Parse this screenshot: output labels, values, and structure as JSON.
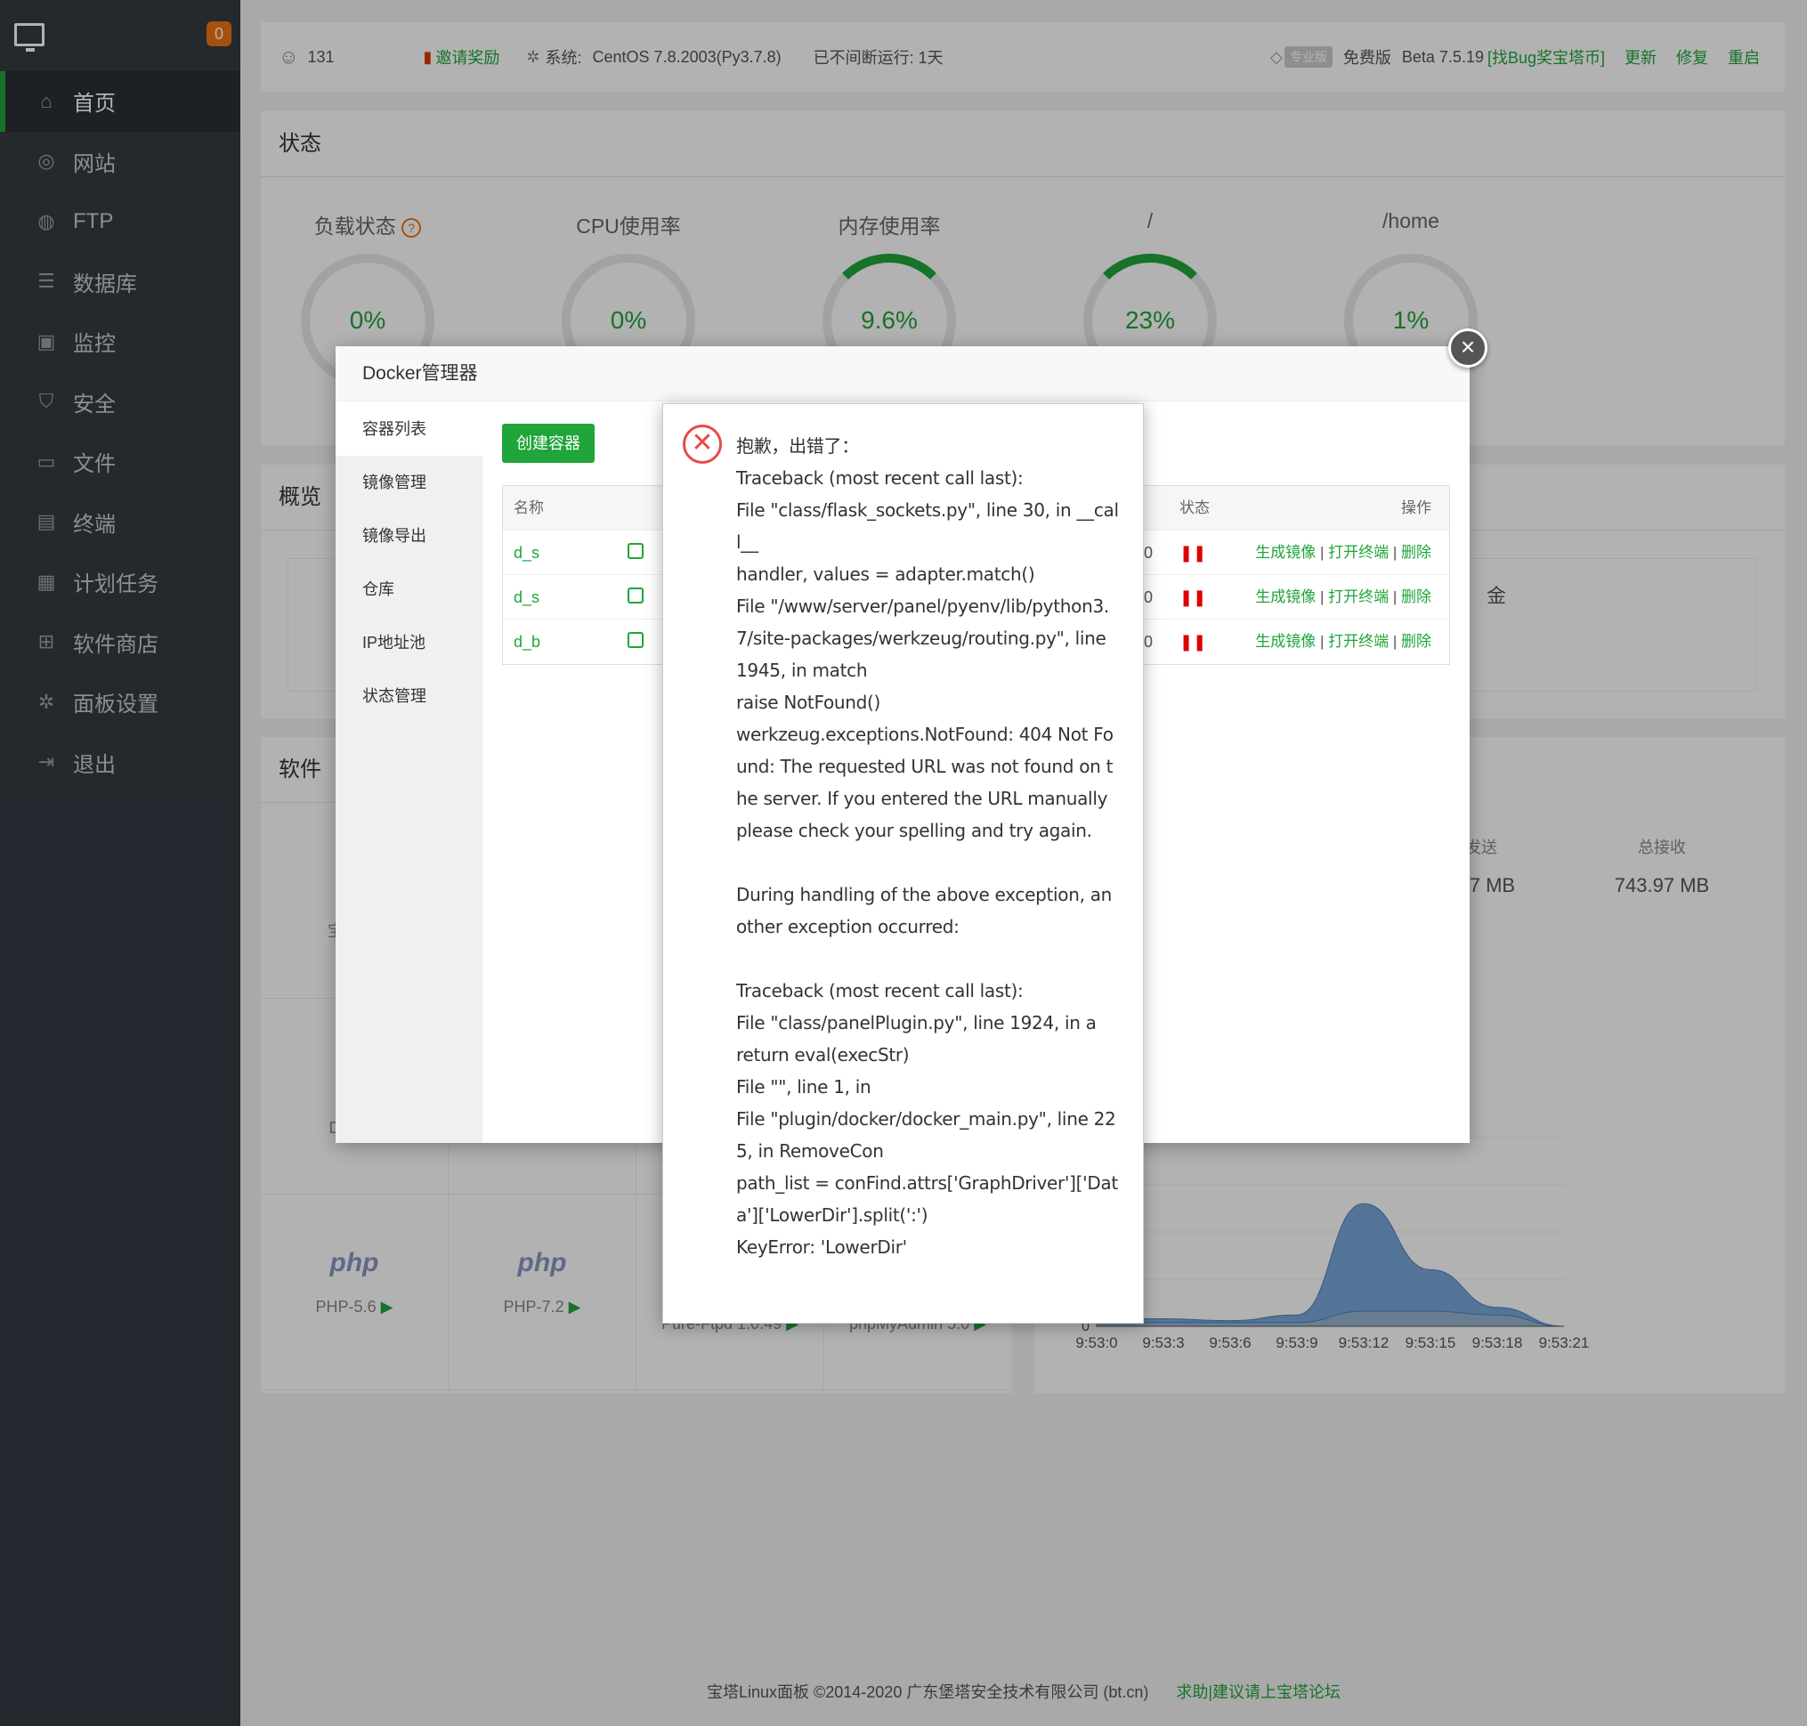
{
  "sidebar": {
    "badge": "0",
    "items": [
      {
        "label": "首页",
        "icon": "home-icon"
      },
      {
        "label": "网站",
        "icon": "globe-icon"
      },
      {
        "label": "FTP",
        "icon": "ftp-icon"
      },
      {
        "label": "数据库",
        "icon": "database-icon"
      },
      {
        "label": "监控",
        "icon": "monitor-icon"
      },
      {
        "label": "安全",
        "icon": "shield-icon"
      },
      {
        "label": "文件",
        "icon": "folder-icon"
      },
      {
        "label": "终端",
        "icon": "terminal-icon"
      },
      {
        "label": "计划任务",
        "icon": "calendar-icon"
      },
      {
        "label": "软件商店",
        "icon": "apps-icon"
      },
      {
        "label": "面板设置",
        "icon": "gear-icon"
      },
      {
        "label": "退出",
        "icon": "logout-icon"
      }
    ]
  },
  "topbar": {
    "user_count": "131",
    "invite": "邀请奖励",
    "system_label": "系统:",
    "system_value": "CentOS 7.8.2003(Py3.7.8)",
    "uptime": "已不间断运行: 1天",
    "pro_badge": "专业版",
    "free": "免费版",
    "version": "Beta 7.5.19",
    "bug_link": "[找Bug奖宝塔币]",
    "update": "更新",
    "repair": "修复",
    "restart": "重启"
  },
  "status": {
    "title": "状态",
    "gauges": [
      {
        "label": "负载状态",
        "value": "0%"
      },
      {
        "label": "CPU使用率",
        "value": "0%"
      },
      {
        "label": "内存使用率",
        "value": "9.6%"
      },
      {
        "label": "/",
        "value": "23%"
      },
      {
        "label": "/home",
        "value": "1%"
      }
    ]
  },
  "overview": {
    "title": "概览",
    "partial": "金"
  },
  "software": {
    "title": "软件",
    "items": [
      {
        "name": "宝塔SS"
      },
      {
        "name": "Docker"
      },
      {
        "name": "PHP-5.6",
        "logo": "php"
      },
      {
        "name": "PHP-7.2",
        "logo": "php"
      },
      {
        "name": "Pure-Ftpd 1.0.49"
      },
      {
        "name": "phpMyAdmin 5.0"
      }
    ]
  },
  "traffic": {
    "sent_label": "总发送",
    "sent_value": "35.57 MB",
    "recv_label": "总接收",
    "recv_value": "743.97 MB"
  },
  "chart_data": {
    "type": "area",
    "x": [
      "9:53:0",
      "9:53:3",
      "9:53:6",
      "9:53:9",
      "9:53:12",
      "9:53:15",
      "9:53:18",
      "9:53:21"
    ],
    "series": [
      {
        "values": [
          4,
          4,
          3,
          6,
          65,
          30,
          10,
          0
        ]
      },
      {
        "values": [
          2,
          2,
          2,
          2,
          8,
          8,
          6,
          0
        ]
      }
    ],
    "ylabel": "",
    "xlabel": "",
    "ylim": [
      0,
      100
    ],
    "y_tick_shown": "0",
    "colors": [
      "#6a9ed6",
      "#9fb6cc"
    ]
  },
  "dialog": {
    "title": "Docker管理器",
    "tabs": [
      "容器列表",
      "镜像管理",
      "镜像导出",
      "仓库",
      "IP地址池",
      "状态管理"
    ],
    "create_button": "创建容器",
    "table": {
      "headers": {
        "name": "名称",
        "status": "状态",
        "op": "操作"
      },
      "rows": [
        {
          "name": "d_s",
          "zero": "0",
          "status": "❚❚"
        },
        {
          "name": "d_s",
          "zero": "0",
          "status": "❚❚"
        },
        {
          "name": "d_b",
          "zero": "0",
          "status": "❚❚"
        }
      ],
      "ops": {
        "image": "生成镜像",
        "terminal": "打开终端",
        "delete": "删除",
        "sep": "|"
      }
    }
  },
  "error": {
    "message": "抱歉，出错了：\nTraceback (most recent call last):\nFile \"class/flask_sockets.py\", line 30, in __call__\nhandler, values = adapter.match()\nFile \"/www/server/panel/pyenv/lib/python3.7/site-packages/werkzeug/routing.py\", line 1945, in match\nraise NotFound()\nwerkzeug.exceptions.NotFound: 404 Not Found: The requested URL was not found on the server. If you entered the URL manually please check your spelling and try again.\n\nDuring handling of the above exception, another exception occurred:\n\nTraceback (most recent call last):\nFile \"class/panelPlugin.py\", line 1924, in a\nreturn eval(execStr)\nFile \"\", line 1, in\nFile \"plugin/docker/docker_main.py\", line 225, in RemoveCon\npath_list = conFind.attrs['GraphDriver']['Data']['LowerDir'].split(':')\nKeyError: 'LowerDir'"
  },
  "footer": {
    "copyright": "宝塔Linux面板 ©2014-2020 广东堡塔安全技术有限公司 (bt.cn)",
    "link": "求助|建议请上宝塔论坛"
  }
}
